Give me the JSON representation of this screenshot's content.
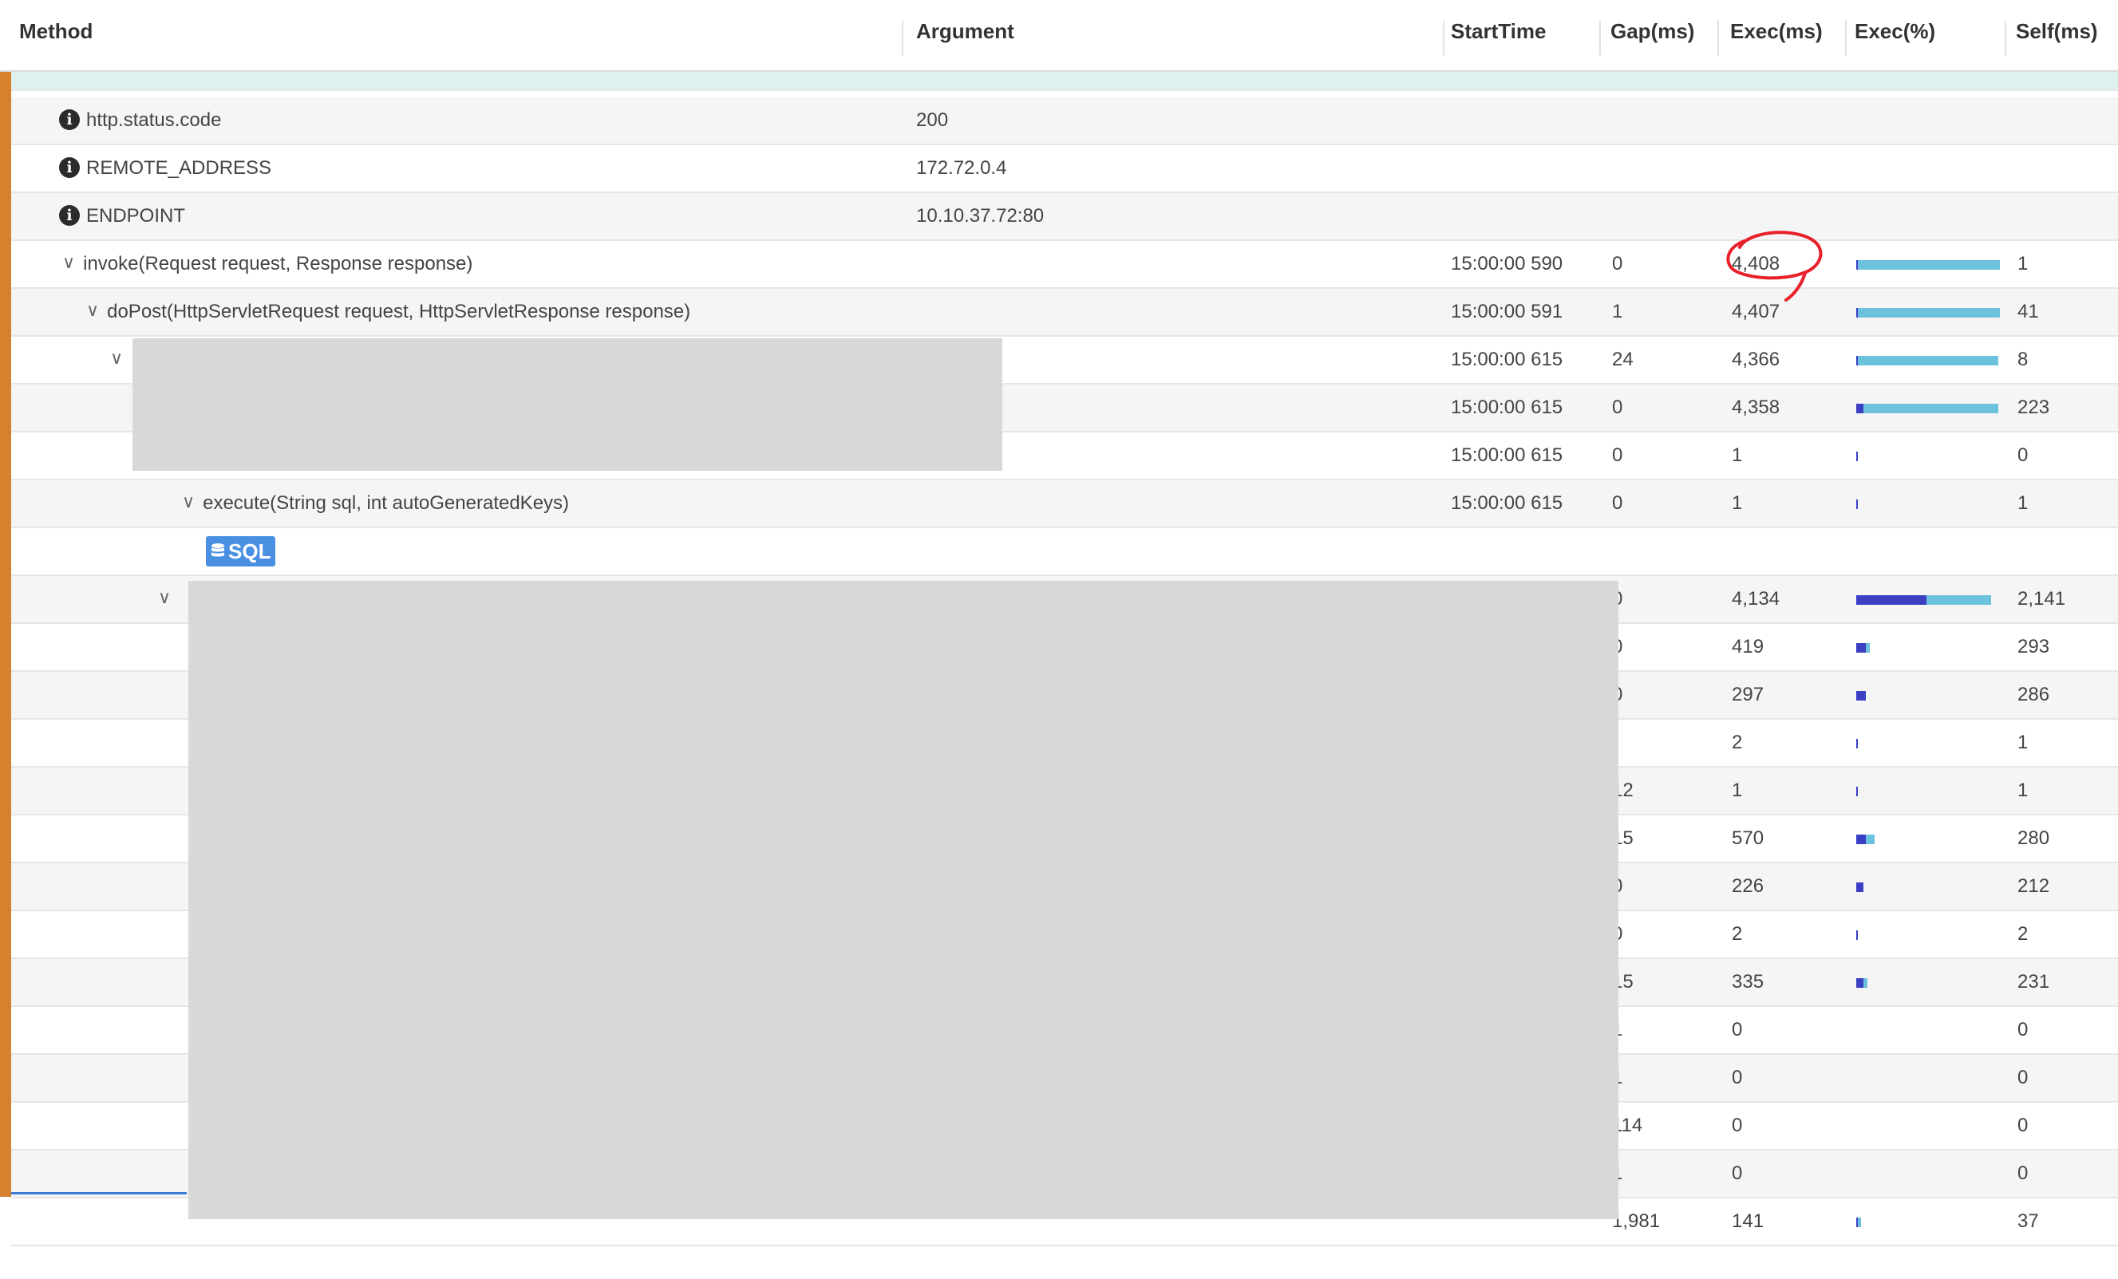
{
  "columns": {
    "method": "Method",
    "argument": "Argument",
    "start": "StartTime",
    "gap": "Gap(ms)",
    "exec": "Exec(ms)",
    "execpct": "Exec(%)",
    "self": "Self(ms)"
  },
  "colors": {
    "accent_bar": "#d7812f",
    "bar_total": "#6cc1dd",
    "bar_self": "#3b3fc4",
    "annotation": "#e8202a"
  },
  "rows": [
    {
      "method": "",
      "argument": "",
      "start": "",
      "gap": "",
      "exec": "",
      "self": "",
      "indent": 0,
      "icon": "none"
    },
    {
      "method": "http.status.code",
      "argument": "200",
      "start": "",
      "gap": "",
      "exec": "",
      "self": "",
      "indent": 60,
      "icon": "info"
    },
    {
      "method": "REMOTE_ADDRESS",
      "argument": "172.72.0.4",
      "start": "",
      "gap": "",
      "exec": "",
      "self": "",
      "indent": 60,
      "icon": "info"
    },
    {
      "method": "ENDPOINT",
      "argument": "10.10.37.72:80",
      "start": "",
      "gap": "",
      "exec": "",
      "self": "",
      "indent": 60,
      "icon": "info"
    },
    {
      "method": "invoke(Request request, Response response)",
      "argument": "",
      "start": "15:00:00 590",
      "gap": "0",
      "exec": "4,408",
      "self": "1",
      "indent": 64,
      "icon": "chevron",
      "exec_pct": 1.0,
      "self_pct": 0.0
    },
    {
      "method": "doPost(HttpServletRequest request, HttpServletResponse response)",
      "argument": "",
      "start": "15:00:00 591",
      "gap": "1",
      "exec": "4,407",
      "self": "41",
      "indent": 94,
      "icon": "chevron",
      "exec_pct": 1.0,
      "self_pct": 0.01
    },
    {
      "method": "",
      "argument": "",
      "start": "15:00:00 615",
      "gap": "24",
      "exec": "4,366",
      "self": "8",
      "indent": 124,
      "icon": "chevron",
      "exec_pct": 0.99,
      "self_pct": 0.002
    },
    {
      "method": "",
      "argument": "",
      "start": "15:00:00 615",
      "gap": "0",
      "exec": "4,358",
      "self": "223",
      "indent": 154,
      "icon": "none",
      "exec_pct": 0.99,
      "self_pct": 0.05
    },
    {
      "method": "",
      "argument": "",
      "start": "15:00:00 615",
      "gap": "0",
      "exec": "1",
      "self": "0",
      "indent": 184,
      "icon": "none",
      "exec_pct": 0.0,
      "self_pct": 0.0
    },
    {
      "method": "execute(String sql, int autoGeneratedKeys)",
      "argument": "",
      "start": "15:00:00 615",
      "gap": "0",
      "exec": "1",
      "self": "1",
      "indent": 214,
      "icon": "chevron",
      "exec_pct": 0.0,
      "self_pct": 0.0
    },
    {
      "method": "",
      "argument": "",
      "start": "",
      "gap": "",
      "exec": "",
      "self": "",
      "indent": 244,
      "icon": "sql"
    },
    {
      "method": "",
      "argument": "",
      "start": "",
      "gap": "0",
      "exec": "4,134",
      "self": "2,141",
      "indent": 184,
      "icon": "chevron",
      "exec_pct": 0.94,
      "self_pct": 0.49
    },
    {
      "method": "",
      "argument": "",
      "start": "",
      "gap": "0",
      "exec": "419",
      "self": "293",
      "indent": 214,
      "icon": "none",
      "exec_pct": 0.095,
      "self_pct": 0.066
    },
    {
      "method": "",
      "argument": "",
      "start": "",
      "gap": "0",
      "exec": "297",
      "self": "286",
      "indent": 214,
      "icon": "none",
      "exec_pct": 0.067,
      "self_pct": 0.065
    },
    {
      "method": "",
      "argument": "",
      "start": "",
      "gap": "",
      "exec": "2",
      "self": "1",
      "indent": 214,
      "icon": "none",
      "exec_pct": 0.0,
      "self_pct": 0.0
    },
    {
      "method": "",
      "argument": "",
      "start": "",
      "gap": "12",
      "exec": "1",
      "self": "1",
      "indent": 214,
      "icon": "none",
      "exec_pct": 0.0,
      "self_pct": 0.0
    },
    {
      "method": "",
      "argument": "",
      "start": "",
      "gap": "15",
      "exec": "570",
      "self": "280",
      "indent": 214,
      "icon": "none",
      "exec_pct": 0.13,
      "self_pct": 0.064
    },
    {
      "method": "",
      "argument": "",
      "start": "",
      "gap": "0",
      "exec": "226",
      "self": "212",
      "indent": 214,
      "icon": "none",
      "exec_pct": 0.051,
      "self_pct": 0.048
    },
    {
      "method": "",
      "argument": "",
      "start": "",
      "gap": "0",
      "exec": "2",
      "self": "2",
      "indent": 214,
      "icon": "none",
      "exec_pct": 0.0,
      "self_pct": 0.0
    },
    {
      "method": "",
      "argument": "",
      "start": "",
      "gap": "15",
      "exec": "335",
      "self": "231",
      "indent": 214,
      "icon": "none",
      "exec_pct": 0.076,
      "self_pct": 0.052
    },
    {
      "method": "",
      "argument": "",
      "start": "",
      "gap": "1",
      "exec": "0",
      "self": "0",
      "indent": 214,
      "icon": "none"
    },
    {
      "method": "",
      "argument": "",
      "start": "",
      "gap": "1",
      "exec": "0",
      "self": "0",
      "indent": 214,
      "icon": "none"
    },
    {
      "method": "",
      "argument": "",
      "start": "",
      "gap": "114",
      "exec": "0",
      "self": "0",
      "indent": 214,
      "icon": "none"
    },
    {
      "method": "",
      "argument": "",
      "start": "",
      "gap": "1",
      "exec": "0",
      "self": "0",
      "indent": 214,
      "icon": "none"
    },
    {
      "method": "",
      "argument": "",
      "start": "",
      "gap": "1,981",
      "exec": "141",
      "self": "37",
      "indent": 214,
      "icon": "none",
      "exec_pct": 0.032,
      "self_pct": 0.008
    }
  ],
  "sql_badge": "SQL"
}
